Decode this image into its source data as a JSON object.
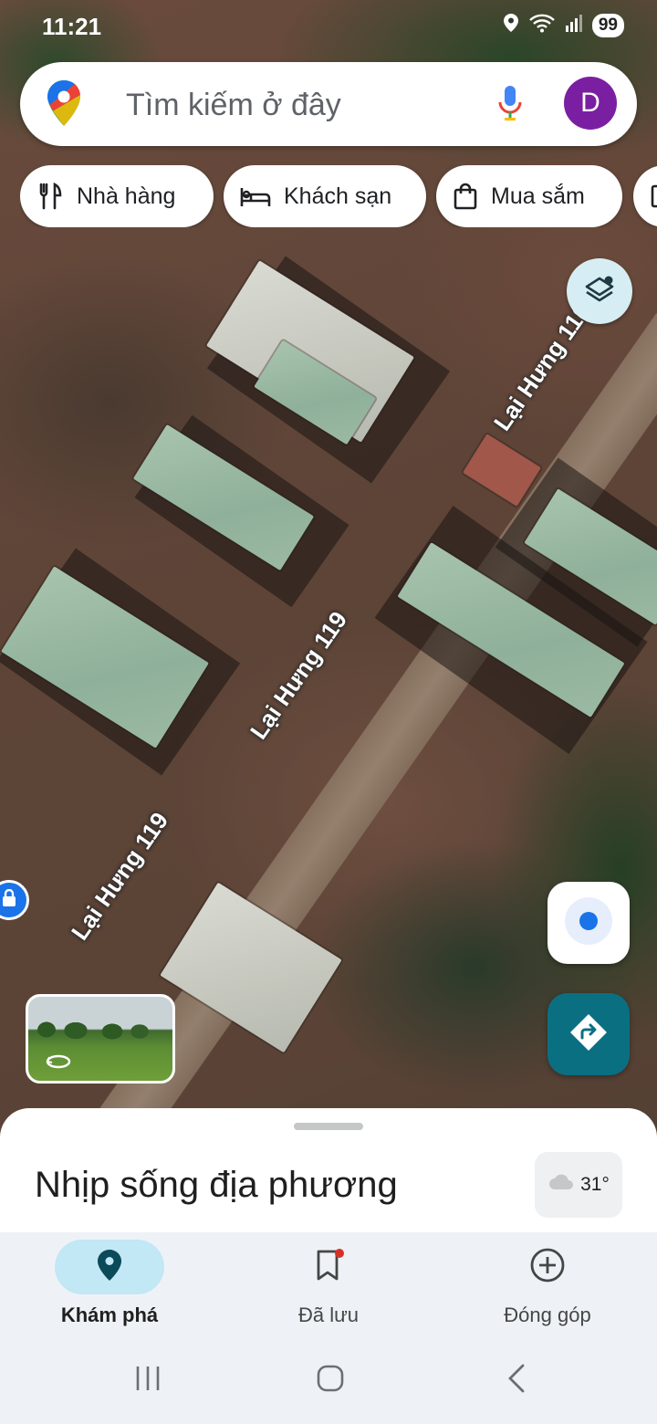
{
  "status_bar": {
    "time": "11:21",
    "battery": "99",
    "icons": [
      "location-icon",
      "wifi-icon",
      "signal-icon"
    ]
  },
  "search": {
    "placeholder": "Tìm kiếm ở đây",
    "avatar_letter": "D",
    "avatar_color": "#7b1fa2"
  },
  "chips": [
    {
      "label": "Nhà hàng",
      "icon": "restaurant-icon"
    },
    {
      "label": "Khách sạn",
      "icon": "hotel-icon"
    },
    {
      "label": "Mua sắm",
      "icon": "shopping-bag-icon"
    }
  ],
  "map": {
    "street_labels": [
      "Lại Hưng 119",
      "Lại Hưng 119",
      "Lại Hưng 119"
    ],
    "view": "satellite"
  },
  "bottom_sheet": {
    "title": "Nhịp sống địa phương",
    "weather": "31°",
    "weather_icon": "cloud-icon"
  },
  "nav": {
    "items": [
      {
        "label": "Khám phá",
        "icon": "explore-pin-icon",
        "active": true
      },
      {
        "label": "Đã lưu",
        "icon": "bookmark-icon",
        "active": false,
        "badge": true
      },
      {
        "label": "Đóng góp",
        "icon": "add-circle-icon",
        "active": false
      }
    ]
  },
  "colors": {
    "accent": "#0b6f82",
    "active_nav_bg": "#c2e7f5",
    "location_dot": "#1a73e8"
  }
}
